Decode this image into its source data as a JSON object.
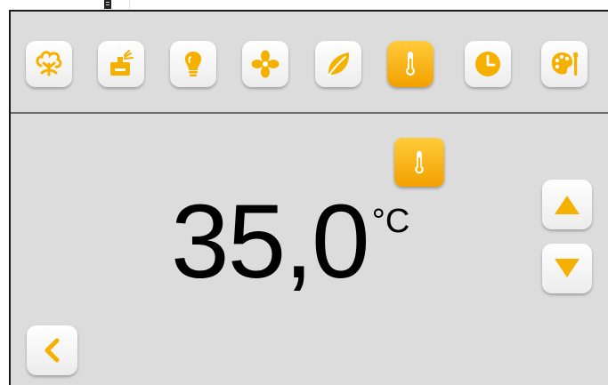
{
  "colors": {
    "accent": "#f6b100",
    "accent_dark": "#e08e00",
    "panel_bg": "#dcdcdc",
    "border": "#1a1a1a"
  },
  "toolbar": {
    "items": [
      {
        "icon": "plant-icon",
        "active": false
      },
      {
        "icon": "sprinkler-icon",
        "active": false
      },
      {
        "icon": "lightbulb-icon",
        "active": false
      },
      {
        "icon": "fan-icon",
        "active": false
      },
      {
        "icon": "leaf-icon",
        "active": false
      },
      {
        "icon": "thermometer-icon",
        "active": true
      },
      {
        "icon": "clock-icon",
        "active": false
      },
      {
        "icon": "palette-icon",
        "active": false
      }
    ]
  },
  "main": {
    "mode_icon": "thermometer-icon",
    "temperature": {
      "value": "35,0",
      "unit": "°C"
    },
    "controls": {
      "up_icon": "triangle-up-icon",
      "down_icon": "triangle-down-icon",
      "back_icon": "chevron-left-icon"
    }
  }
}
